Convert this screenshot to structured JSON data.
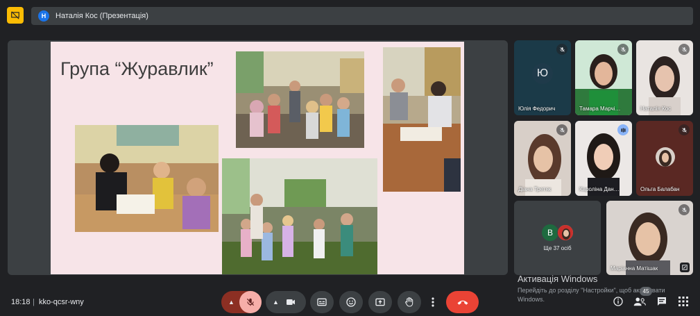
{
  "presentation": {
    "presenter_initial": "Н",
    "presenter_label": "Наталія Кос (Презентація)",
    "slide_title": "Група “Журавлик”"
  },
  "participants": [
    {
      "name": "Юлія Федорич",
      "initial": "Ю",
      "muted": true
    },
    {
      "name": "Тамара Марчі…",
      "muted": true
    },
    {
      "name": "Наталія Кос",
      "muted": true
    },
    {
      "name": "Діана Третяк",
      "muted": true
    },
    {
      "name": "Кароліна Дан…",
      "muted": false,
      "speaking": true
    },
    {
      "name": "Ольга Балабан",
      "muted": true
    },
    {
      "name": "Маріанна Матішак",
      "muted": true
    }
  ],
  "more": {
    "initial": "В",
    "label": "Ще 37 осіб"
  },
  "watermark": {
    "title": "Активація Windows",
    "subtitle": "Перейдіть до розділу \"Настройки\", щоб активувати Windows."
  },
  "bottom": {
    "time": "18:18",
    "separator": "|",
    "meeting_code": "kko-qcsr-wny",
    "people_count": "45"
  },
  "colors": {
    "background": "#202124",
    "surface": "#3c4043",
    "hangup": "#ea4335",
    "mic_off": "#f6aea9",
    "accent": "#8ab4f8"
  }
}
